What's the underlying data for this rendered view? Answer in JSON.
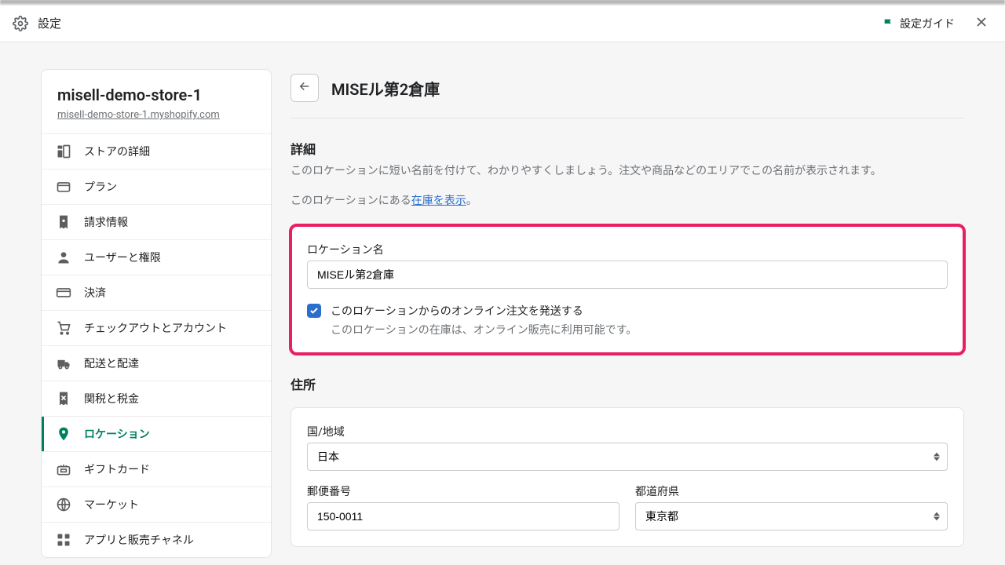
{
  "topbar": {
    "title": "設定",
    "guide_label": "設定ガイド"
  },
  "store": {
    "name": "misell-demo-store-1",
    "url": "misell-demo-store-1.myshopify.com"
  },
  "nav": {
    "items": [
      "ストアの詳細",
      "プラン",
      "請求情報",
      "ユーザーと権限",
      "決済",
      "チェックアウトとアカウント",
      "配送と配達",
      "関税と税金",
      "ロケーション",
      "ギフトカード",
      "マーケット",
      "アプリと販売チャネル"
    ],
    "active_index": 8
  },
  "page": {
    "title": "MISEル第2倉庫"
  },
  "details_section": {
    "heading": "詳細",
    "description": "このロケーションに短い名前を付けて、わかりやすくしましょう。注文や商品などのエリアでこの名前が表示されます。",
    "inventory_prefix": "このロケーションにある",
    "inventory_link": "在庫を表示",
    "inventory_suffix": "。"
  },
  "location_form": {
    "name_label": "ロケーション名",
    "name_value": "MISEル第2倉庫",
    "fulfill_checked": true,
    "fulfill_label": "このロケーションからのオンライン注文を発送する",
    "fulfill_help": "このロケーションの在庫は、オンライン販売に利用可能です。"
  },
  "address_section": {
    "heading": "住所",
    "country_label": "国/地域",
    "country_value": "日本",
    "postal_label": "郵便番号",
    "postal_value": "150-0011",
    "prefecture_label": "都道府県",
    "prefecture_value": "東京都"
  }
}
